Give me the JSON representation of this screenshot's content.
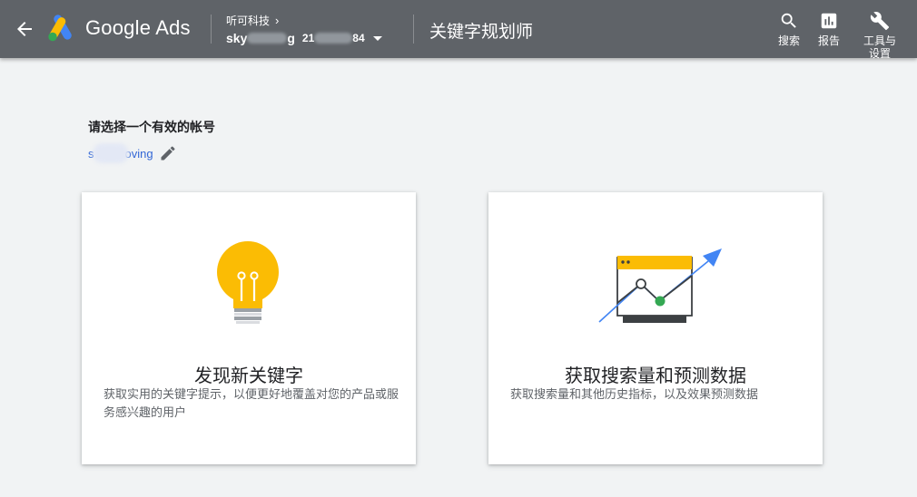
{
  "header": {
    "product_name": "Google Ads",
    "account_parent": "听可科技",
    "account_name_prefix": "sky",
    "account_name_suffix": "g",
    "account_id_prefix": "21",
    "account_id_suffix": "84",
    "tool_title": "关键字规划师",
    "actions": [
      {
        "icon": "search-icon",
        "label": "搜索"
      },
      {
        "icon": "reports-icon",
        "label": "报告"
      },
      {
        "icon": "wrench-icon",
        "label": "工具与设置"
      }
    ]
  },
  "main": {
    "choose_account_title": "请选择一个有效的帐号",
    "account_prefix": "s",
    "account_suffix": "oving"
  },
  "cards": [
    {
      "title": "发现新关键字",
      "description": "获取实用的关键字提示，以便更好地覆盖对您的产品或服务感兴趣的用户"
    },
    {
      "title": "获取搜索量和预测数据",
      "description": "获取搜索量和其他历史指标，以及效果预测数据"
    }
  ],
  "colors": {
    "header_bg": "#5f6368",
    "page_bg": "#f1f3f4",
    "link_blue": "#3367d6",
    "bulb_yellow": "#fbbc04",
    "trend_blue": "#4285f4",
    "point_green": "#34a853"
  }
}
